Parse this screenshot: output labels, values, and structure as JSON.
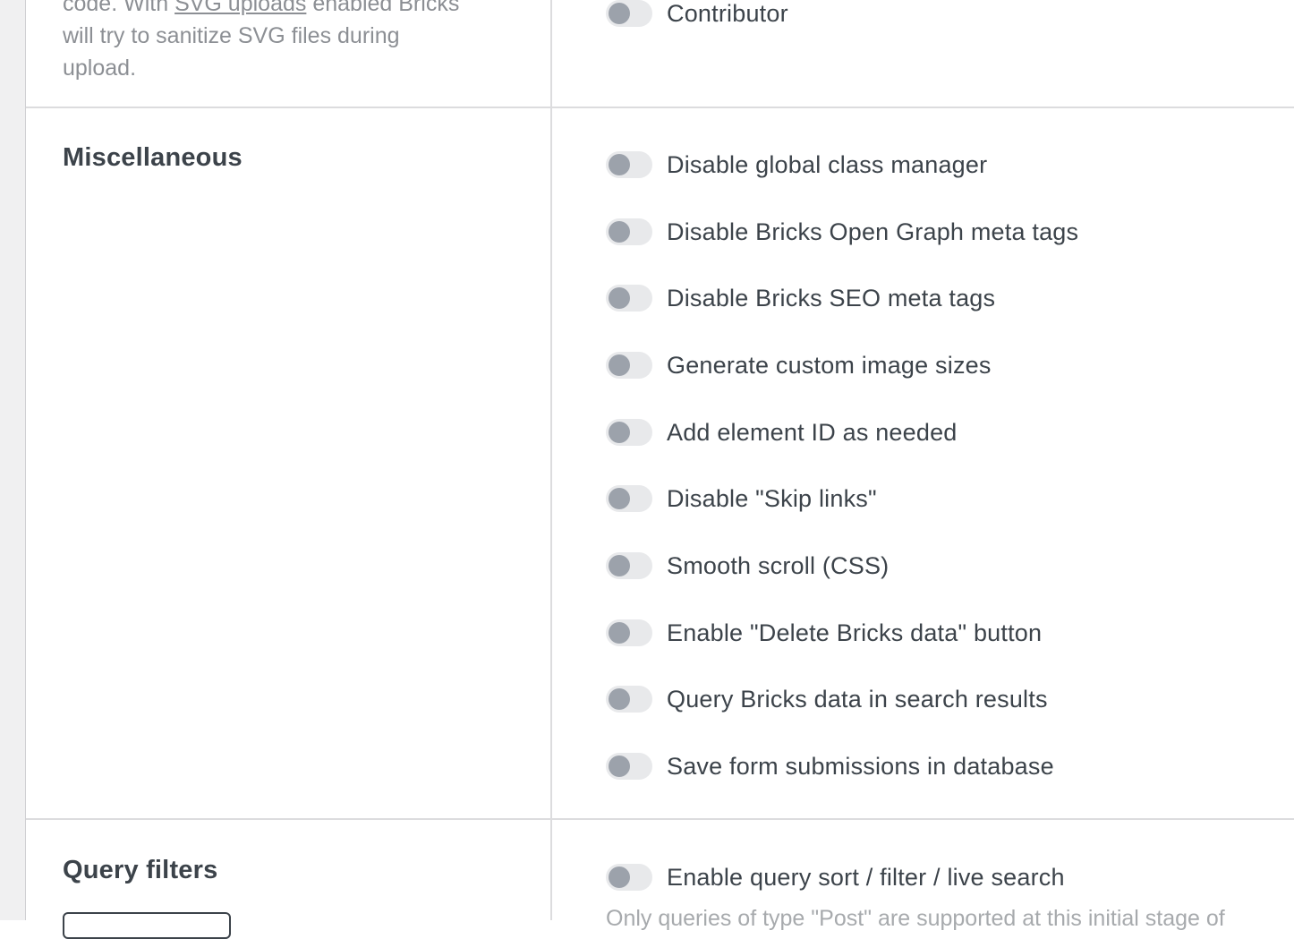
{
  "svg_section": {
    "description_prefix": "code. With ",
    "description_link": "SVG uploads",
    "description_suffix": " enabled Bricks",
    "description_line2": "will try to sanitize SVG files during",
    "description_line3": "upload.",
    "role_option": {
      "label": "Contributor",
      "enabled": false
    }
  },
  "misc_section": {
    "title": "Miscellaneous",
    "options": [
      {
        "label": "Disable global class manager",
        "enabled": false
      },
      {
        "label": "Disable Bricks Open Graph meta tags",
        "enabled": false
      },
      {
        "label": "Disable Bricks SEO meta tags",
        "enabled": false
      },
      {
        "label": "Generate custom image sizes",
        "enabled": false
      },
      {
        "label": "Add element ID as needed",
        "enabled": false
      },
      {
        "label": "Disable \"Skip links\"",
        "enabled": false
      },
      {
        "label": "Smooth scroll (CSS)",
        "enabled": false
      },
      {
        "label": "Enable \"Delete Bricks data\" button",
        "enabled": false
      },
      {
        "label": "Query Bricks data in search results",
        "enabled": false
      },
      {
        "label": "Save form submissions in database",
        "enabled": false
      }
    ]
  },
  "query_filters_section": {
    "title": "Query filters",
    "option": {
      "label": "Enable query sort / filter / live search",
      "enabled": false
    },
    "note": "Only queries of type \"Post\" are supported at this initial stage of"
  }
}
